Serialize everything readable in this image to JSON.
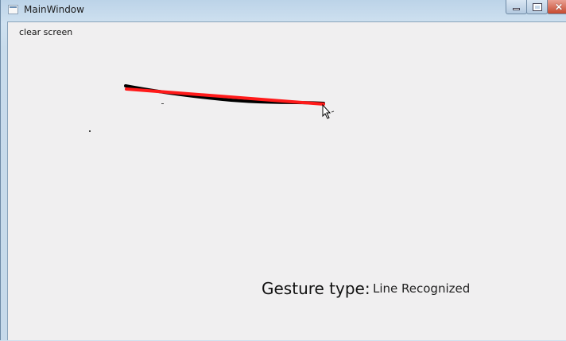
{
  "window": {
    "title": "MainWindow",
    "controls": {
      "minimize": "minimize",
      "maximize": "maximize",
      "close": "close"
    }
  },
  "toolbar": {
    "clear_label": "clear screen"
  },
  "canvas": {
    "stroke_colors": {
      "drawn": "#000000",
      "recognized": "#ff0000"
    }
  },
  "status": {
    "gesture_label": "Gesture type:",
    "gesture_value": "Line Recognized"
  },
  "colors": {
    "client_bg": "#f0eff0",
    "frame": "#c6d9ea"
  }
}
